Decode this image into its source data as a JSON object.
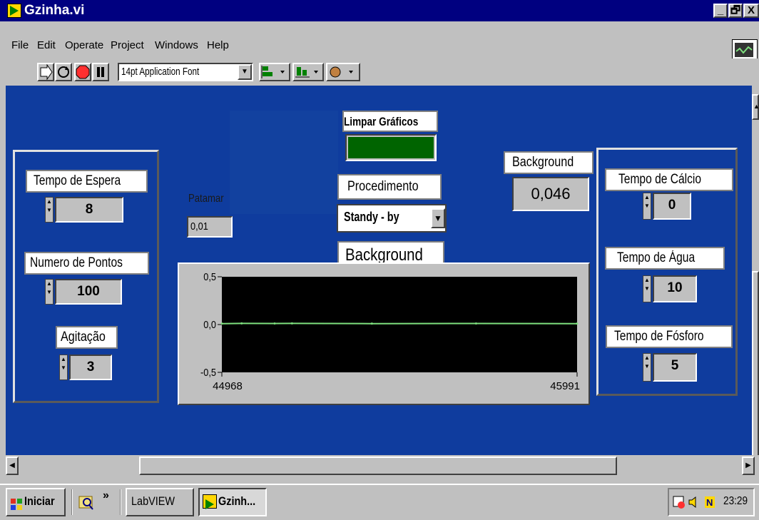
{
  "window": {
    "title": "Gzinha.vi",
    "min": "_",
    "max": "🗗",
    "close": "X"
  },
  "menu": [
    "File",
    "Edit",
    "Operate",
    "Project",
    "Windows",
    "Help"
  ],
  "toolbar": {
    "font": "14pt Application Font",
    "vi_icon_number": "3"
  },
  "left_panel": {
    "tempo_espera": {
      "label": "Tempo de Espera",
      "value": "8"
    },
    "numero_pontos": {
      "label": "Numero de Pontos",
      "value": "100"
    },
    "agitacao": {
      "label": "Agitação",
      "value": "3"
    }
  },
  "center": {
    "limpar_label": "Limpar Gráficos",
    "procedimento_label": "Procedimento",
    "procedimento_value": "Standy - by",
    "graph_title": "Background",
    "patamar_label": "Patamar",
    "patamar_value": "0,01",
    "bg_indicator_label": "Background",
    "bg_indicator_value": "0,046"
  },
  "right_panel": {
    "tempo_calcio": {
      "label": "Tempo de Cálcio",
      "value": "0"
    },
    "tempo_agua": {
      "label": "Tempo de Água",
      "value": "10"
    },
    "tempo_fosforo": {
      "label": "Tempo de Fósforo",
      "value": "5"
    }
  },
  "chart_data": {
    "type": "line",
    "title": "Background",
    "x_ticks": [
      "44968",
      "45991"
    ],
    "y_ticks": [
      "0,5",
      "0,0",
      "-0,5"
    ],
    "xlim": [
      44968,
      45991
    ],
    "ylim": [
      -0.5,
      0.5
    ],
    "series": [
      {
        "color": "#7ee07e",
        "x": [
          44968,
          45025,
          45120,
          45170,
          45400,
          45700,
          45991
        ],
        "y": [
          0.01,
          0.012,
          0.011,
          0.012,
          0.01,
          0.011,
          0.01
        ]
      }
    ],
    "grid": false
  },
  "taskbar": {
    "start": "Iniciar",
    "task1": "LabVIEW",
    "task2": "Gzinh...",
    "clock": "23:29"
  },
  "colors": {
    "panel": "#0f3c9e",
    "titlebar": "#000080",
    "led": "#006400",
    "plot_bg": "#000000",
    "trace": "#7ee07e"
  }
}
